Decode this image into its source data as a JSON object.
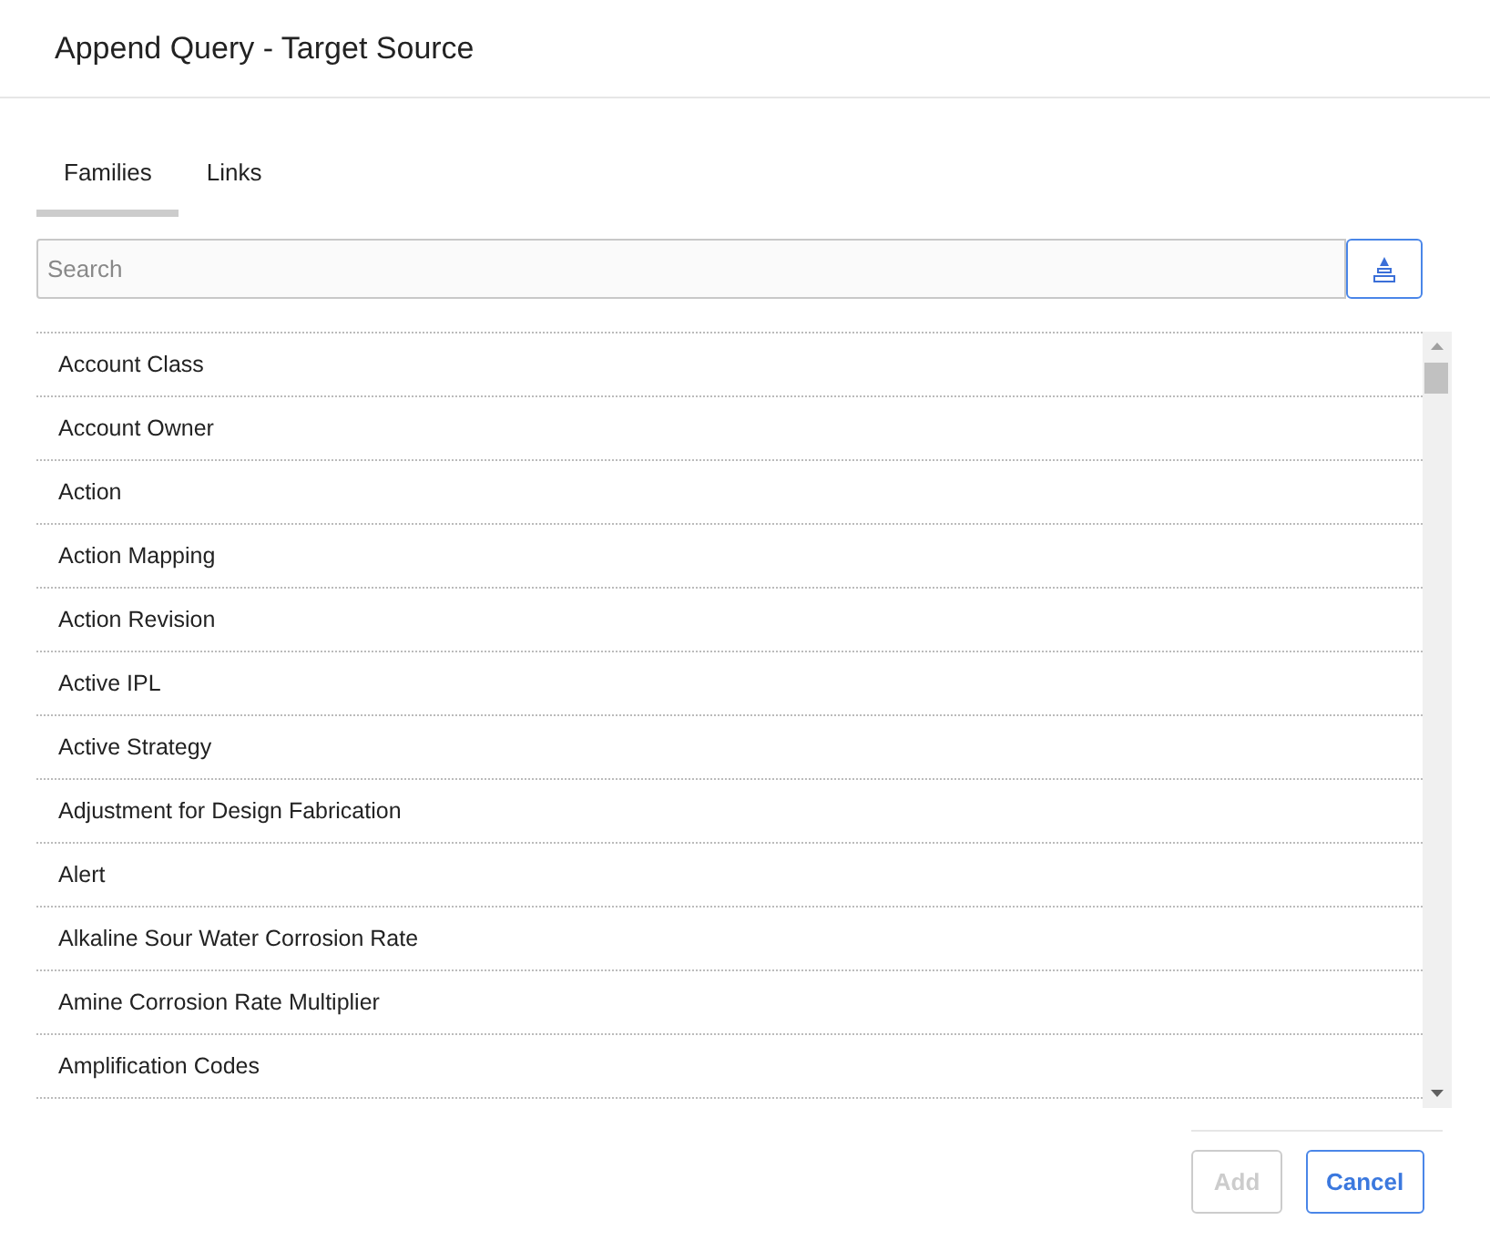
{
  "window": {
    "title": "Append Query - Target Source"
  },
  "tabs": [
    {
      "label": "Families",
      "selected": true
    },
    {
      "label": "Links",
      "selected": false
    }
  ],
  "search": {
    "placeholder": "Search"
  },
  "items": [
    "Account Class",
    "Account Owner",
    "Action",
    "Action Mapping",
    "Action Revision",
    "Active IPL",
    "Active Strategy",
    "Adjustment for Design Fabrication",
    "Alert",
    "Alkaline Sour Water Corrosion Rate",
    "Amine Corrosion Rate Multiplier",
    "Amplification Codes"
  ],
  "buttons": [
    {
      "label": "Add",
      "disabled": true
    },
    {
      "label": "Cancel",
      "disabled": false
    }
  ]
}
